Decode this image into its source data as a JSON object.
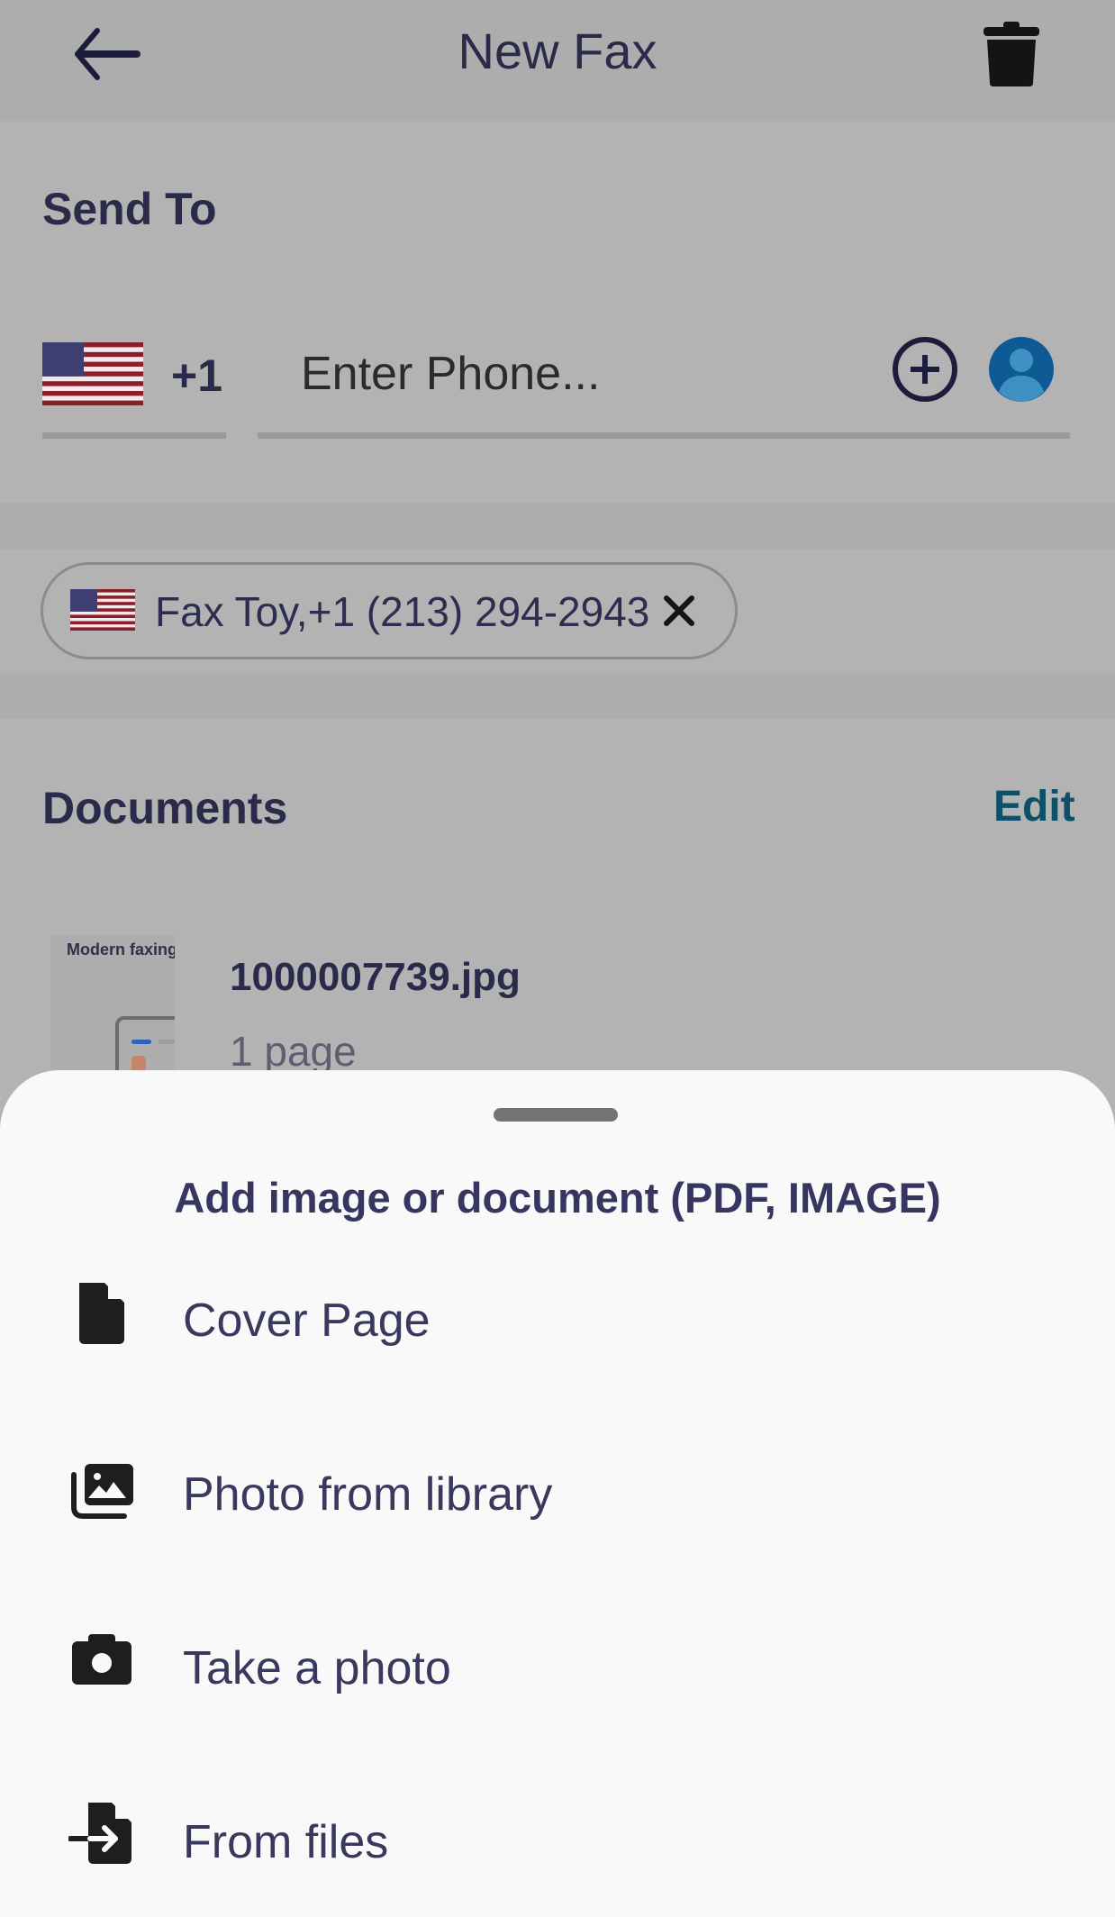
{
  "header": {
    "title": "New Fax",
    "back_icon": "arrow-left-icon",
    "delete_icon": "trash-icon"
  },
  "send_to": {
    "title": "Send To",
    "country_code": "+1",
    "country_flag": "us-flag-icon",
    "phone_input": {
      "value": "",
      "placeholder": "Enter Phone..."
    },
    "add_icon": "plus-circle-icon",
    "contacts_icon": "contact-avatar-icon"
  },
  "recipients": [
    {
      "flag": "us-flag-icon",
      "label": "Fax Toy,+1 (213) 294-2943",
      "remove_icon": "close-icon"
    }
  ],
  "documents": {
    "title": "Documents",
    "edit_label": "Edit",
    "items": [
      {
        "thumbnail_caption": "Modern faxing",
        "name": "1000007739.jpg",
        "pages": "1 page"
      }
    ]
  },
  "bottom_sheet": {
    "title": "Add image or document (PDF, IMAGE)",
    "options": [
      {
        "icon": "file-icon",
        "label": "Cover Page"
      },
      {
        "icon": "photo-library-icon",
        "label": "Photo from library"
      },
      {
        "icon": "camera-icon",
        "label": "Take a photo"
      },
      {
        "icon": "file-import-icon",
        "label": "From files"
      }
    ]
  },
  "colors": {
    "primary_text": "#2a2a4a",
    "link": "#0d5068",
    "contact_avatar": "#1565a0",
    "sheet_background": "#f9f9f9",
    "scrim": "#b3b3b3"
  }
}
